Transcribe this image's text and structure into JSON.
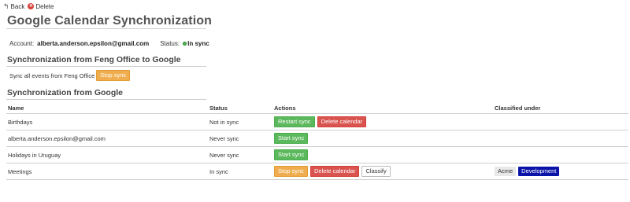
{
  "toolbar": {
    "back_label": "Back",
    "delete_label": "Delete"
  },
  "page": {
    "title": "Google Calendar Synchronization"
  },
  "account": {
    "label": "Account:",
    "email": "alberta.anderson.epsilon@gmail.com",
    "status_label": "Status:",
    "status_value": "In sync",
    "status_color": "#4caf50"
  },
  "feng_to_google": {
    "title": "Synchronization from Feng Office to Google",
    "sync_all_label": "Sync all events from Feng Office",
    "stop_sync_label": "Stop sync"
  },
  "from_google": {
    "title": "Synchronization from Google",
    "columns": {
      "name": "Name",
      "status": "Status",
      "actions": "Actions",
      "classified": "Classified under"
    },
    "rows": [
      {
        "name": "Birthdays",
        "status": "Not in sync",
        "action1": "Restart sync",
        "action2": "Delete calendar"
      },
      {
        "name": "alberta.anderson.epsilon@gmail.com",
        "status": "Never sync",
        "action1": "Start sync"
      },
      {
        "name": "Holidays in Uruguay",
        "status": "Never sync",
        "action1": "Start sync"
      },
      {
        "name": "Meetings",
        "status": "In sync",
        "action1": "Stop sync",
        "action2": "Delete calendar",
        "action3": "Classify",
        "tags": [
          "Acme",
          "Development"
        ]
      }
    ]
  },
  "colors": {
    "orange": "#f0ad4e",
    "green": "#5cb85c",
    "red": "#d9534f",
    "tag_blue": "#0a14a8"
  }
}
